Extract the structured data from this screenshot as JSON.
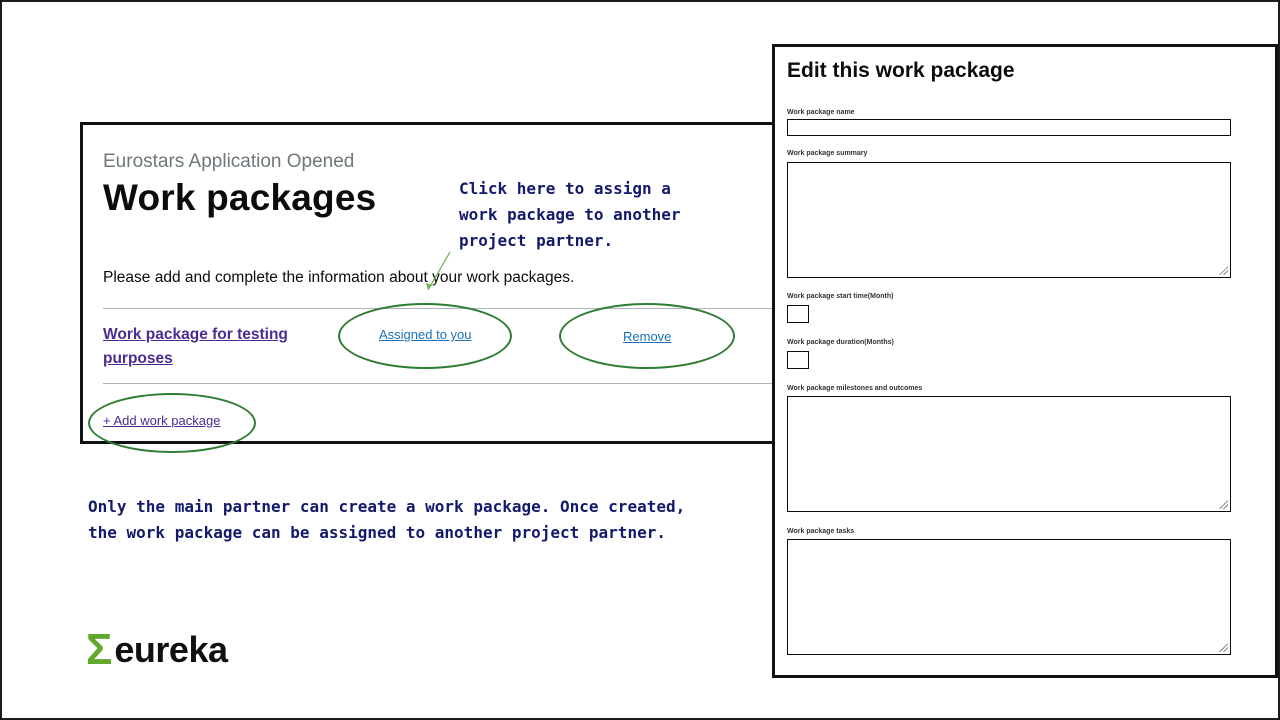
{
  "work_packages": {
    "caption": "Eurostars Application Opened",
    "heading": "Work packages",
    "intro": "Please add and complete the information about your work packages.",
    "item_name": "Work package for testing purposes",
    "assigned_label": "Assigned to you",
    "remove_label": "Remove",
    "add_label": "+ Add work package"
  },
  "notes": {
    "assign_hint": "Click here to assign a\nwork package to another\nproject partner.",
    "main_partner": "Only the main partner can create a work package. Once created,\nthe work package can be assigned to another project partner."
  },
  "logo": {
    "text": "eureka",
    "icon": "sigma-icon"
  },
  "edit_form": {
    "title": "Edit this work package",
    "labels": {
      "name": "Work package name",
      "summary": "Work package summary",
      "start_time": "Work package start time(Month)",
      "duration": "Work package duration(Months)",
      "milestones": "Work package milestones and outcomes",
      "tasks": "Work package tasks"
    }
  },
  "colors": {
    "highlight": "#2e7d32",
    "note_text": "#141a6b",
    "link": "#1d70b8",
    "visited_link": "#4c2c92",
    "logo_green": "#61a92c"
  }
}
